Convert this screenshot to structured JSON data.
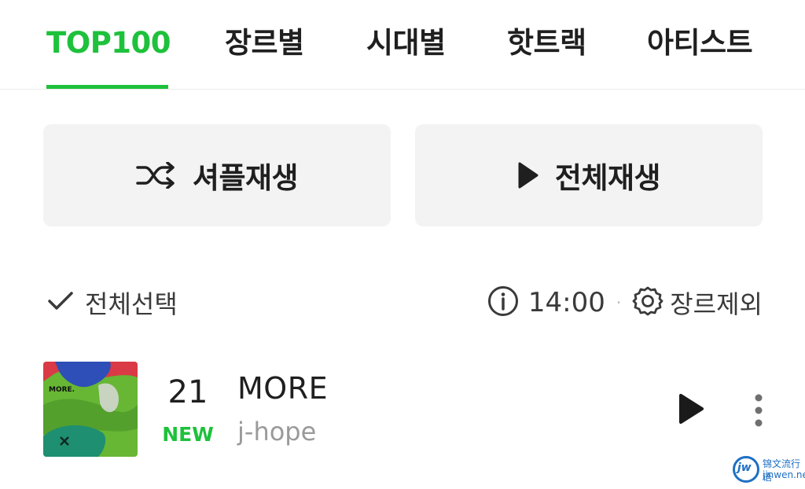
{
  "tabs": [
    {
      "label": "TOP100",
      "active": true
    },
    {
      "label": "장르별",
      "active": false
    },
    {
      "label": "시대별",
      "active": false
    },
    {
      "label": "핫트랙",
      "active": false
    },
    {
      "label": "아티스트",
      "active": false
    }
  ],
  "actions": {
    "shuffle_label": "셔플재생",
    "play_all_label": "전체재생"
  },
  "toolbar": {
    "select_all_label": "전체선택",
    "time": "14:00",
    "separator": "·",
    "genre_exclude_label": "장르제외"
  },
  "tracks": [
    {
      "rank": "21",
      "badge": "NEW",
      "title": "MORE",
      "artist": "j-hope",
      "album_art_text": "MORE."
    }
  ],
  "watermark": {
    "logo": "jw",
    "chinese": "锦文流行语",
    "url": "jinwen.net"
  },
  "colors": {
    "accent": "#1ec13b",
    "button_bg": "#f3f3f3",
    "text_primary": "#1f1f1f",
    "text_secondary": "#9a9a9a"
  },
  "icons": {
    "shuffle": "shuffle-icon",
    "play": "play-icon",
    "check": "check-icon",
    "info": "info-icon",
    "settings": "gear-icon",
    "more": "more-vertical-icon"
  }
}
